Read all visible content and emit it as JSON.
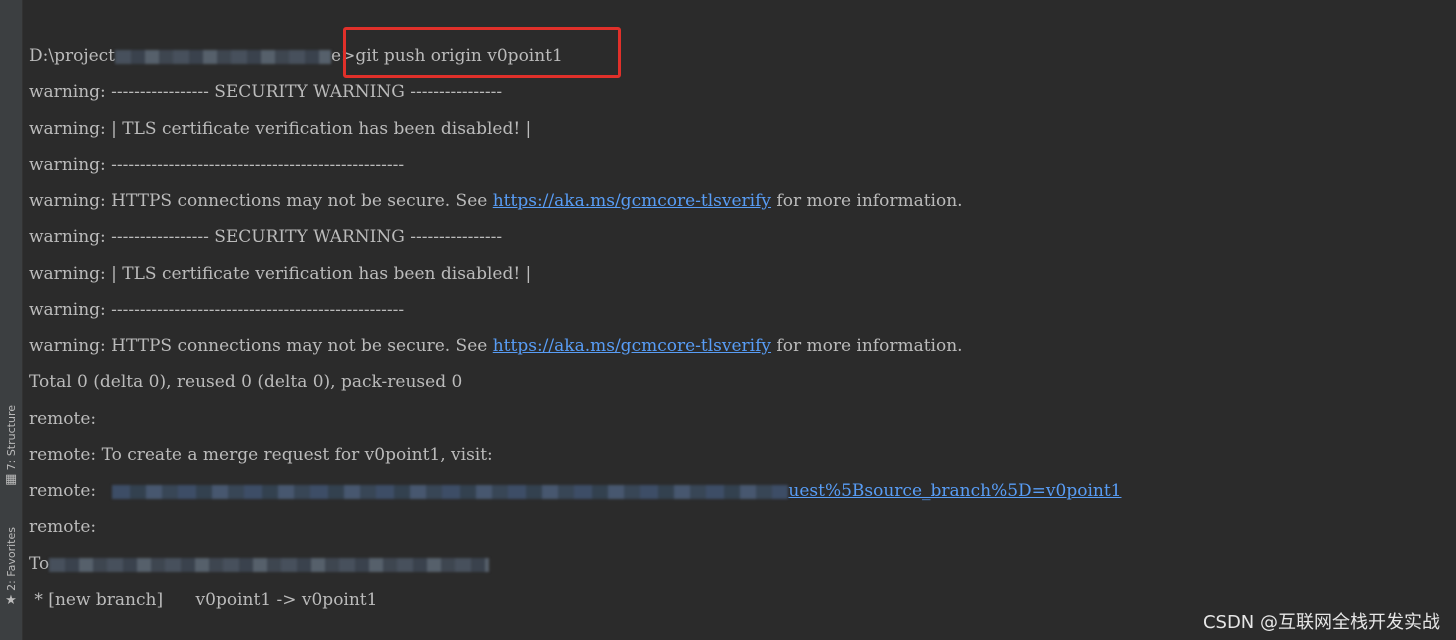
{
  "sidebar": {
    "structure_tab": {
      "label": "7: Structure",
      "icon": "structure-icon"
    },
    "favorites_tab": {
      "label": "2: Favorites",
      "icon": "star-icon"
    }
  },
  "terminal": {
    "prompt_prefix": "D:\\project",
    "prompt_suffix": "e>",
    "command": "git push origin v0point1",
    "warn_1": "warning: ----------------- SECURITY WARNING ----------------",
    "warn_2": "warning: | TLS certificate verification has been disabled! |",
    "warn_3": "warning: ---------------------------------------------------",
    "warn_4_pre": "warning: HTTPS connections may not be secure. See ",
    "warn_4_link": "https://aka.ms/gcmcore-tlsverify",
    "warn_4_post": " for more information.",
    "warn_5": "warning: ----------------- SECURITY WARNING ----------------",
    "warn_6": "warning: | TLS certificate verification has been disabled! |",
    "warn_7": "warning: ---------------------------------------------------",
    "warn_8_pre": "warning: HTTPS connections may not be secure. See ",
    "warn_8_link": "https://aka.ms/gcmcore-tlsverify",
    "warn_8_post": " for more information.",
    "total": "Total 0 (delta 0), reused 0 (delta 0), pack-reused 0",
    "remote_1": "remote:",
    "remote_2": "remote: To create a merge request for v0point1, visit:",
    "remote_3_pre": "remote:   ",
    "remote_3_link": "uest%5Bsource_branch%5D=v0point1",
    "remote_4": "remote:",
    "to_prefix": "To",
    "new_branch": " * [new branch]      v0point1 -> v0point1"
  },
  "colors": {
    "background": "#2b2b2b",
    "text": "#bbbbbb",
    "link": "#589df6",
    "highlight": "#e0302a"
  },
  "watermark": "CSDN @互联网全栈开发实战"
}
